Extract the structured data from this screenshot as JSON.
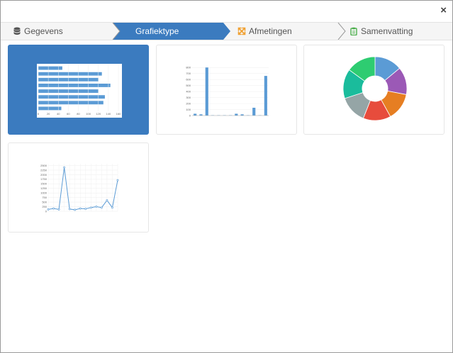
{
  "wizard": {
    "steps": [
      {
        "label": "Gegevens",
        "icon": "database-icon"
      },
      {
        "label": "Grafiektype",
        "icon": "chart-type-icon"
      },
      {
        "label": "Afmetingen",
        "icon": "resize-arrows-icon"
      },
      {
        "label": "Samenvatting",
        "icon": "clipboard-icon"
      }
    ],
    "active_step": 1
  },
  "close_label": "×",
  "colors": {
    "accent": "#3b7bbf",
    "resize_icon": "#f0a030",
    "clipboard_icon": "#4cae4c",
    "bar_fill": "#5b9bd5"
  },
  "tiles": [
    {
      "name": "horizontal-bar-chart",
      "selected": true
    },
    {
      "name": "vertical-bar-chart",
      "selected": false
    },
    {
      "name": "donut-chart",
      "selected": false
    },
    {
      "name": "line-chart",
      "selected": false
    }
  ],
  "chart_data": [
    {
      "type": "bar",
      "orientation": "horizontal",
      "values": [
        48,
        127,
        120,
        144,
        120,
        133,
        130,
        46
      ],
      "xticks": [
        "0",
        "20",
        "40",
        "60",
        "80",
        "100",
        "120",
        "140",
        "160"
      ],
      "xlim": [
        0,
        160
      ]
    },
    {
      "type": "bar",
      "values": [
        30,
        20,
        800,
        5,
        5,
        5,
        5,
        30,
        20,
        5,
        130,
        5,
        660
      ],
      "yticks": [
        "0",
        "100",
        "200",
        "300",
        "400",
        "500",
        "600",
        "700",
        "800"
      ],
      "ylim": [
        0,
        850
      ]
    },
    {
      "type": "pie",
      "donut": true,
      "values": [
        14,
        14,
        14,
        14,
        14,
        15,
        15
      ],
      "colors": [
        "#5b9bd5",
        "#9b59b6",
        "#e67e22",
        "#e74c3c",
        "#95a5a6",
        "#1abc9c",
        "#2ecc71"
      ]
    },
    {
      "type": "line",
      "values": [
        100,
        150,
        100,
        2400,
        120,
        80,
        150,
        130,
        200,
        250,
        200,
        600,
        200,
        1700
      ],
      "yticks": [
        "0",
        "250",
        "500",
        "750",
        "1000",
        "1250",
        "1500",
        "1750",
        "2000",
        "2250",
        "2500"
      ],
      "ylim": [
        0,
        2600
      ]
    }
  ]
}
